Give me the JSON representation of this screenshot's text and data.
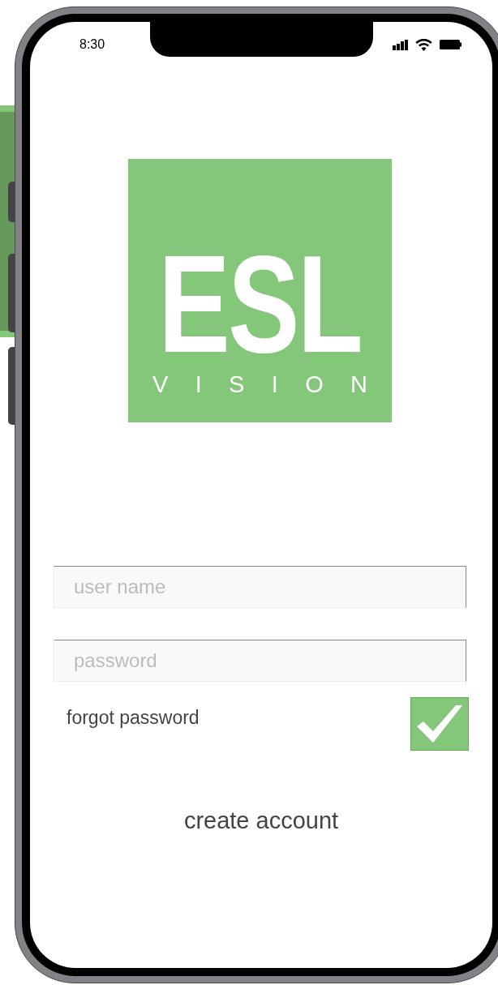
{
  "status_bar": {
    "time": "8:30"
  },
  "logo": {
    "title": "ESL",
    "subtitle": "VISION"
  },
  "fields": [
    {
      "placeholder": "user name"
    },
    {
      "placeholder": "password"
    }
  ],
  "forgot_password": {
    "label": "forgot password",
    "checked": true
  },
  "create_account": "create account"
}
